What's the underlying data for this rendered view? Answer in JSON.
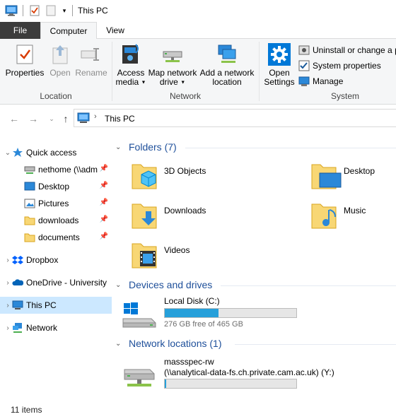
{
  "window": {
    "title": "This PC"
  },
  "ribbon": {
    "tabs": {
      "file": "File",
      "computer": "Computer",
      "view": "View"
    },
    "location": {
      "label": "Location",
      "properties": "Properties",
      "open": "Open",
      "rename": "Rename"
    },
    "network": {
      "label": "Network",
      "access_media_line1": "Access",
      "access_media_line2": "media",
      "map_drive_line1": "Map network",
      "map_drive_line2": "drive",
      "add_location_line1": "Add a network",
      "add_location_line2": "location"
    },
    "system": {
      "label": "System",
      "open_settings_line1": "Open",
      "open_settings_line2": "Settings",
      "uninstall": "Uninstall or change a p",
      "system_properties": "System properties",
      "manage": "Manage"
    }
  },
  "address": {
    "path": "This PC"
  },
  "nav": {
    "quick_access": "Quick access",
    "pinned": [
      {
        "label": "nethome (\\\\adm"
      },
      {
        "label": "Desktop"
      },
      {
        "label": "Pictures"
      },
      {
        "label": "downloads"
      },
      {
        "label": "documents"
      }
    ],
    "dropbox": "Dropbox",
    "onedrive": "OneDrive - University",
    "this_pc": "This PC",
    "network": "Network"
  },
  "content": {
    "folders_header": "Folders (7)",
    "folders": [
      {
        "name": "3D Objects",
        "icon": "3d-objects-icon"
      },
      {
        "name": "Desktop",
        "icon": "desktop-folder-icon"
      },
      {
        "name": "Downloads",
        "icon": "downloads-folder-icon"
      },
      {
        "name": "Music",
        "icon": "music-folder-icon"
      },
      {
        "name": "Videos",
        "icon": "videos-folder-icon"
      }
    ],
    "devices_header": "Devices and drives",
    "local_disk": {
      "name": "Local Disk (C:)",
      "free": "276 GB free of 465 GB",
      "used_fraction": 0.406
    },
    "network_header": "Network locations (1)",
    "network_drive": {
      "name_line1": "massspec-rw",
      "name_line2": "(\\\\analytical-data-fs.ch.private.cam.ac.uk) (Y:)",
      "used_fraction": 0.01
    }
  },
  "status": {
    "items": "11 items"
  },
  "colors": {
    "accent": "#0078d7",
    "selection": "#cce8ff",
    "header_blue": "#1e4f9a",
    "bar_fill": "#26a0da"
  }
}
